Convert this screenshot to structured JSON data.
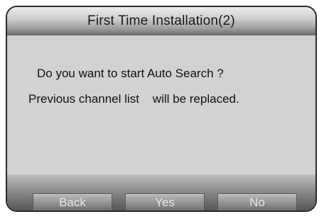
{
  "dialog": {
    "title": "First Time Installation(2)",
    "message_line_1": "Do you want to start Auto Search ?",
    "message_line_2": "Previous channel list    will be replaced."
  },
  "buttons": {
    "back_label": "Back",
    "yes_label": "Yes",
    "no_label": "No"
  }
}
